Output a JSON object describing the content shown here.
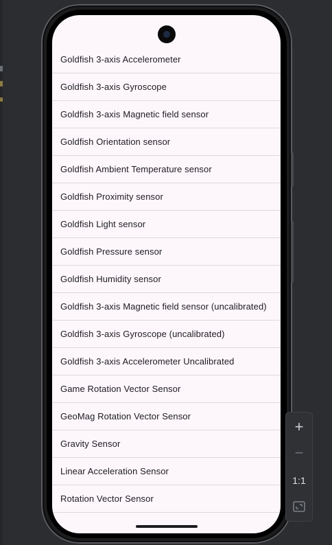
{
  "sensors": {
    "items": [
      {
        "label": "Goldfish 3-axis Accelerometer"
      },
      {
        "label": "Goldfish 3-axis Gyroscope"
      },
      {
        "label": "Goldfish 3-axis Magnetic field sensor"
      },
      {
        "label": "Goldfish Orientation sensor"
      },
      {
        "label": "Goldfish Ambient Temperature sensor"
      },
      {
        "label": "Goldfish Proximity sensor"
      },
      {
        "label": "Goldfish Light sensor"
      },
      {
        "label": "Goldfish Pressure sensor"
      },
      {
        "label": "Goldfish Humidity sensor"
      },
      {
        "label": "Goldfish 3-axis Magnetic field sensor (uncalibrated)"
      },
      {
        "label": "Goldfish 3-axis Gyroscope (uncalibrated)"
      },
      {
        "label": "Goldfish 3-axis Accelerometer Uncalibrated"
      },
      {
        "label": "Game Rotation Vector Sensor"
      },
      {
        "label": "GeoMag Rotation Vector Sensor"
      },
      {
        "label": "Gravity Sensor"
      },
      {
        "label": "Linear Acceleration Sensor"
      },
      {
        "label": "Rotation Vector Sensor"
      }
    ]
  },
  "zoom_toolbar": {
    "zoom_in_symbol": "+",
    "zoom_out_symbol": "−",
    "actual_size_label": "1:1",
    "fit_icon": "fit-screen-icon"
  },
  "colors": {
    "screen_background": "#fdf7fc",
    "list_divider": "#dcd8dc",
    "text": "#1d1b20",
    "ide_background": "#2b2d30"
  }
}
